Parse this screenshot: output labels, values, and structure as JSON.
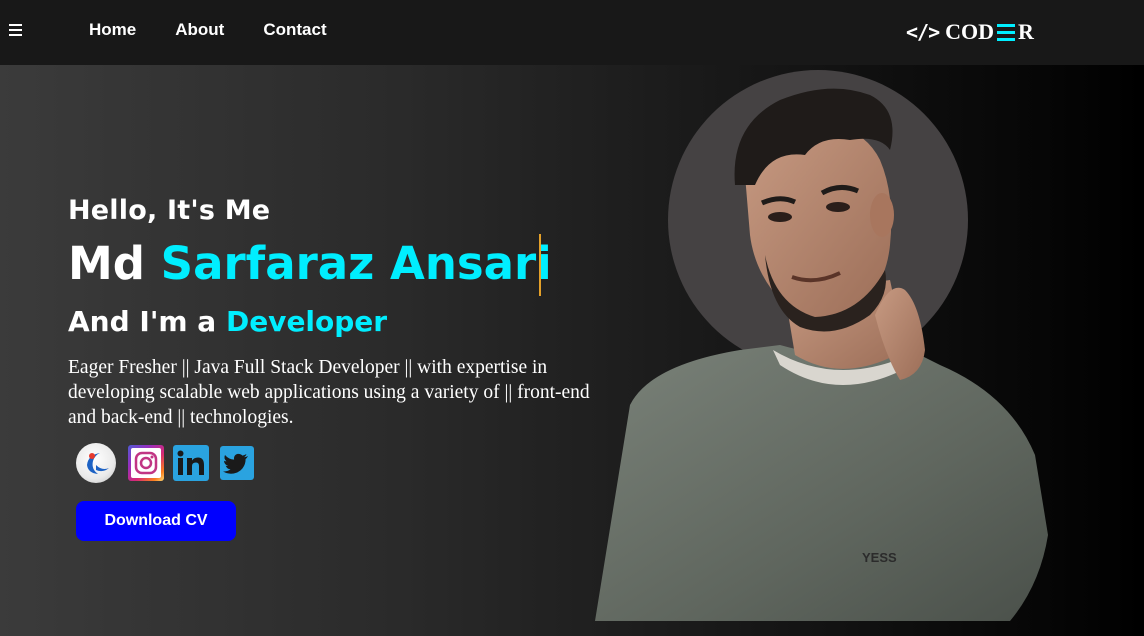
{
  "nav": {
    "menu_icon": "hamburger-icon",
    "links": [
      "Home",
      "About",
      "Contact"
    ],
    "logo": {
      "icon": "code-icon",
      "icon_text": "</>",
      "text_before": "COD",
      "text_after": "R"
    }
  },
  "hero": {
    "greeting": "Hello, It's Me",
    "name_first": "Md",
    "name_highlight": "Sarfaraz Ansari",
    "role_prefix": "And I'm a",
    "role_highlight": "Developer",
    "description": "Eager Fresher || Java Full Stack Developer || with expertise in developing scalable web applications using a variety of || front-end and back-end || technologies.",
    "socials": [
      "naukri-icon",
      "instagram-icon",
      "linkedin-icon",
      "twitter-icon"
    ],
    "cta_label": "Download CV",
    "portrait_graphic": "YESS"
  },
  "colors": {
    "accent": "#00eeff",
    "cta": "#0000ff",
    "cursor": "#e4a029",
    "nav_bg": "#181818"
  }
}
